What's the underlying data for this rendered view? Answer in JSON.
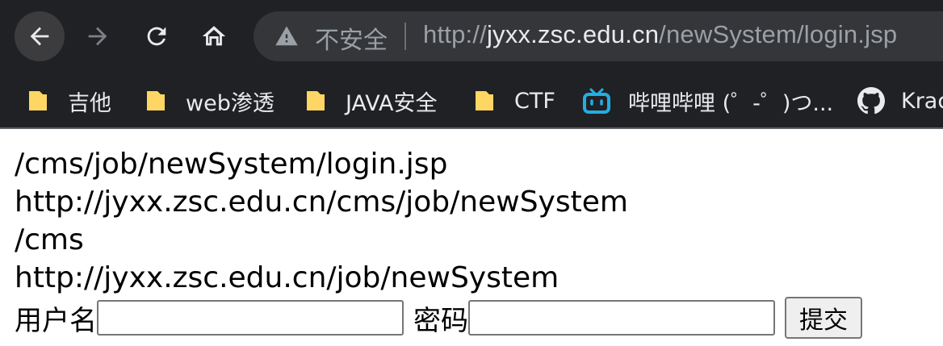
{
  "browser": {
    "security_text": "不安全",
    "url_host": "jyxx.zsc.edu.cn",
    "url_prefix": "http://",
    "url_path": "/newSystem/login.jsp",
    "bookmarks": [
      {
        "label": "吉他",
        "icon": "folder-icon"
      },
      {
        "label": "web渗透",
        "icon": "folder-icon"
      },
      {
        "label": "JAVA安全",
        "icon": "folder-icon"
      },
      {
        "label": "CTF",
        "icon": "folder-icon"
      },
      {
        "label": "哔哩哔哩 (゜-゜)つ...",
        "icon": "bilibili-icon"
      },
      {
        "label": "Krac",
        "icon": "github-icon"
      }
    ]
  },
  "page": {
    "lines": [
      "/cms/job/newSystem/login.jsp",
      "http://jyxx.zsc.edu.cn/cms/job/newSystem",
      "/cms",
      "http://jyxx.zsc.edu.cn/job/newSystem"
    ],
    "form": {
      "username_label": "用户名",
      "username_value": "",
      "password_label": "密码",
      "password_value": "",
      "submit_label": "提交"
    }
  },
  "colors": {
    "chrome_bg": "#202124",
    "omnibox_bg": "#35363a",
    "folder_yellow": "#fdd663",
    "bilibili_blue": "#23ade5"
  }
}
